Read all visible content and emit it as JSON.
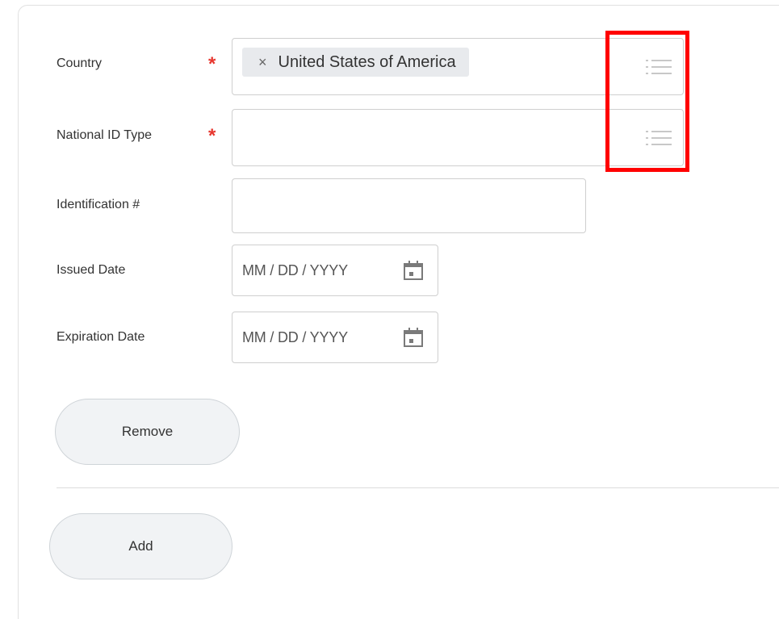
{
  "form": {
    "country": {
      "label": "Country",
      "required_mark": "*",
      "selected_value": "United States of America",
      "remove_glyph": "×",
      "icon": "list-icon"
    },
    "national_id_type": {
      "label": "National ID Type",
      "required_mark": "*",
      "value": "",
      "icon": "list-icon"
    },
    "identification": {
      "label": "Identification #",
      "value": ""
    },
    "issued_date": {
      "label": "Issued Date",
      "placeholder": "MM / DD / YYYY",
      "icon": "calendar-icon"
    },
    "expiration_date": {
      "label": "Expiration Date",
      "placeholder": "MM / DD / YYYY",
      "icon": "calendar-icon"
    }
  },
  "buttons": {
    "remove": "Remove",
    "add": "Add"
  },
  "colors": {
    "required": "#e7372f",
    "highlight": "#ff0000",
    "field_border": "#cfcfcf",
    "pill_bg": "#e8eaed",
    "button_bg": "#f1f3f5"
  }
}
